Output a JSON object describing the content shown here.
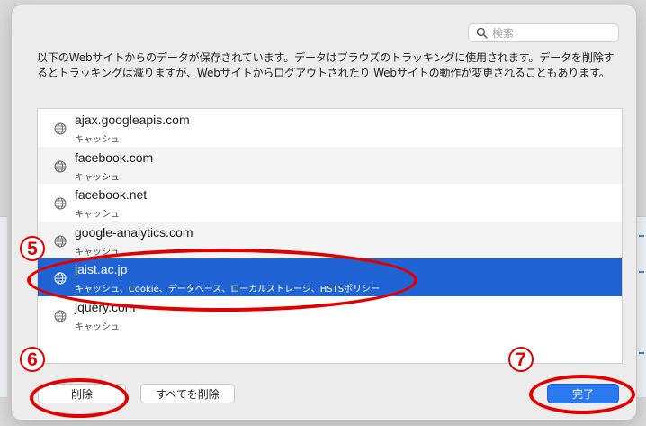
{
  "search": {
    "placeholder": "検索"
  },
  "description": "以下のWebサイトからのデータが保存されています。データはブラウズのトラッキングに使用されます。データを削除するとトラッキングは減りますが、Webサイトからログアウトされたり Webサイトの動作が変更されることもあります。",
  "sites": [
    {
      "domain": "ajax.googleapis.com",
      "data_types": "キャッシュ"
    },
    {
      "domain": "facebook.com",
      "data_types": "キャッシュ"
    },
    {
      "domain": "facebook.net",
      "data_types": "キャッシュ"
    },
    {
      "domain": "google-analytics.com",
      "data_types": "キャッシュ"
    },
    {
      "domain": "jaist.ac.jp",
      "data_types": "キャッシュ、Cookie、データベース、ローカルストレージ、HSTSポリシー",
      "selected": true
    },
    {
      "domain": "jquery.com",
      "data_types": "キャッシュ"
    }
  ],
  "buttons": {
    "delete": "削除",
    "delete_all": "すべてを削除",
    "done": "完了"
  },
  "callouts": {
    "select_site": "5",
    "delete": "6",
    "done": "7"
  },
  "colors": {
    "selection": "#1f63d4",
    "done_button": "#2b79f0",
    "callout": "#e00000"
  },
  "icons": {
    "site": "globe-icon",
    "search": "magnifier-icon"
  }
}
